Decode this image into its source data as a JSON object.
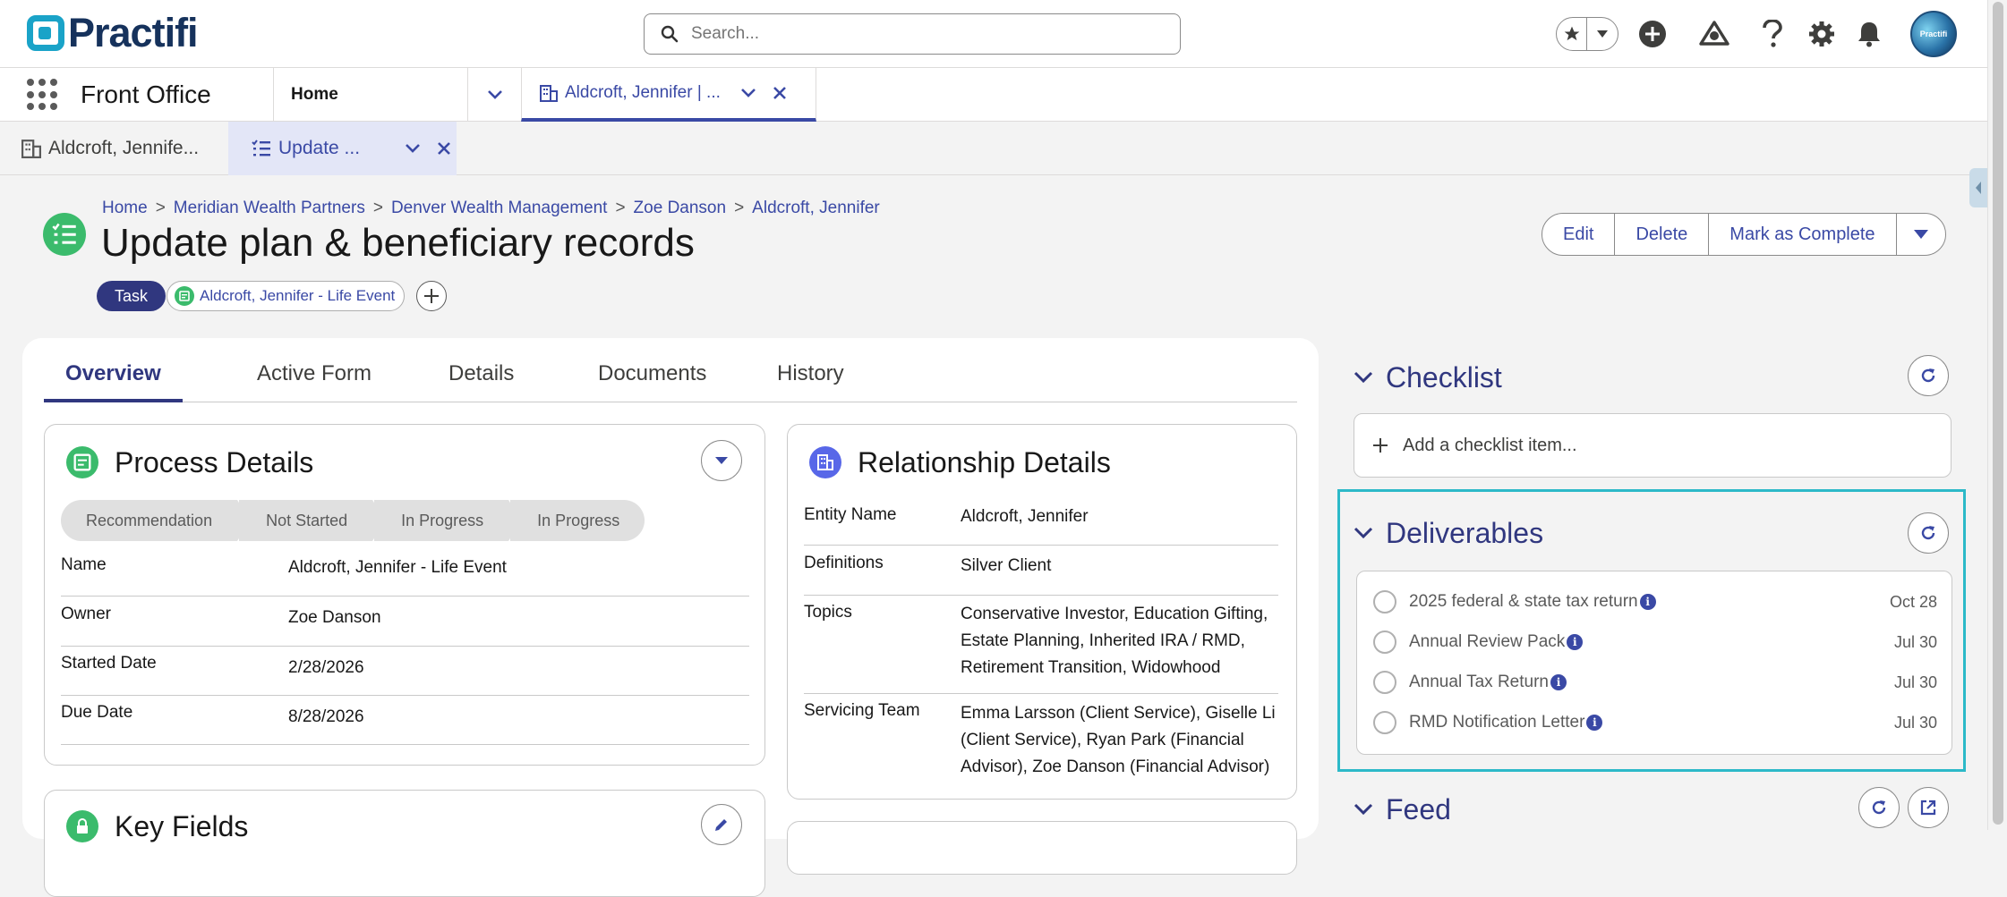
{
  "header": {
    "logo_text": "Practifi",
    "search_placeholder": "Search...",
    "avatar_text": "Practifi"
  },
  "appnav": {
    "app_name": "Front Office",
    "home_label": "Home",
    "open_tab_label": "Aldcroft, Jennifer | ..."
  },
  "subtabs": {
    "tab1_label": "Aldcroft, Jennife...",
    "tab2_label": "Update ..."
  },
  "page": {
    "breadcrumb": [
      "Home",
      "Meridian Wealth Partners",
      "Denver Wealth Management",
      "Zoe Danson",
      "Aldcroft, Jennifer"
    ],
    "breadcrumb_sep": ">",
    "title": "Update plan & beneficiary records",
    "type_pill": "Task",
    "related_pill": "Aldcroft, Jennifer - Life Event",
    "actions": {
      "edit": "Edit",
      "delete": "Delete",
      "complete": "Mark as Complete"
    }
  },
  "main": {
    "tabs": [
      "Overview",
      "Active Form",
      "Details",
      "Documents",
      "History"
    ],
    "active_tab": "Overview",
    "process": {
      "title": "Process Details",
      "stages": [
        "Recommendation",
        "Not Started",
        "In Progress",
        "In Progress"
      ],
      "fields": [
        {
          "label": "Name",
          "value": "Aldcroft, Jennifer - Life Event"
        },
        {
          "label": "Owner",
          "value": "Zoe Danson"
        },
        {
          "label": "Started Date",
          "value": "2/28/2026"
        },
        {
          "label": "Due Date",
          "value": "8/28/2026"
        }
      ]
    },
    "key_fields_title": "Key Fields",
    "relationship": {
      "title": "Relationship Details",
      "fields": [
        {
          "label": "Entity Name",
          "lines": [
            "Aldcroft, Jennifer"
          ]
        },
        {
          "label": "Definitions",
          "lines": [
            "Silver Client"
          ]
        },
        {
          "label": "Topics",
          "lines": [
            "Conservative Investor, Education Gifting,",
            "Estate Planning, Inherited IRA / RMD,",
            "Retirement Transition, Widowhood"
          ]
        },
        {
          "label": "Servicing Team",
          "lines": [
            "Emma Larsson (Client Service), Giselle Li",
            "(Client Service), Ryan Park (Financial",
            "Advisor), Zoe Danson (Financial Advisor)"
          ]
        }
      ]
    }
  },
  "right": {
    "checklist": {
      "title": "Checklist",
      "add_placeholder": "Add a checklist item..."
    },
    "deliverables": {
      "title": "Deliverables",
      "items": [
        {
          "name": "2025 federal & state tax return",
          "date": "Oct 28"
        },
        {
          "name": "Annual Review Pack",
          "date": "Jul 30"
        },
        {
          "name": "Annual Tax Return",
          "date": "Jul 30"
        },
        {
          "name": "RMD Notification Letter",
          "date": "Jul 30"
        }
      ]
    },
    "feed": {
      "title": "Feed"
    }
  },
  "colors": {
    "brand_navy": "#30377f",
    "link_blue": "#3a49a5",
    "teal_highlight": "#2cb9c8",
    "task_green": "#3bbb6c"
  }
}
